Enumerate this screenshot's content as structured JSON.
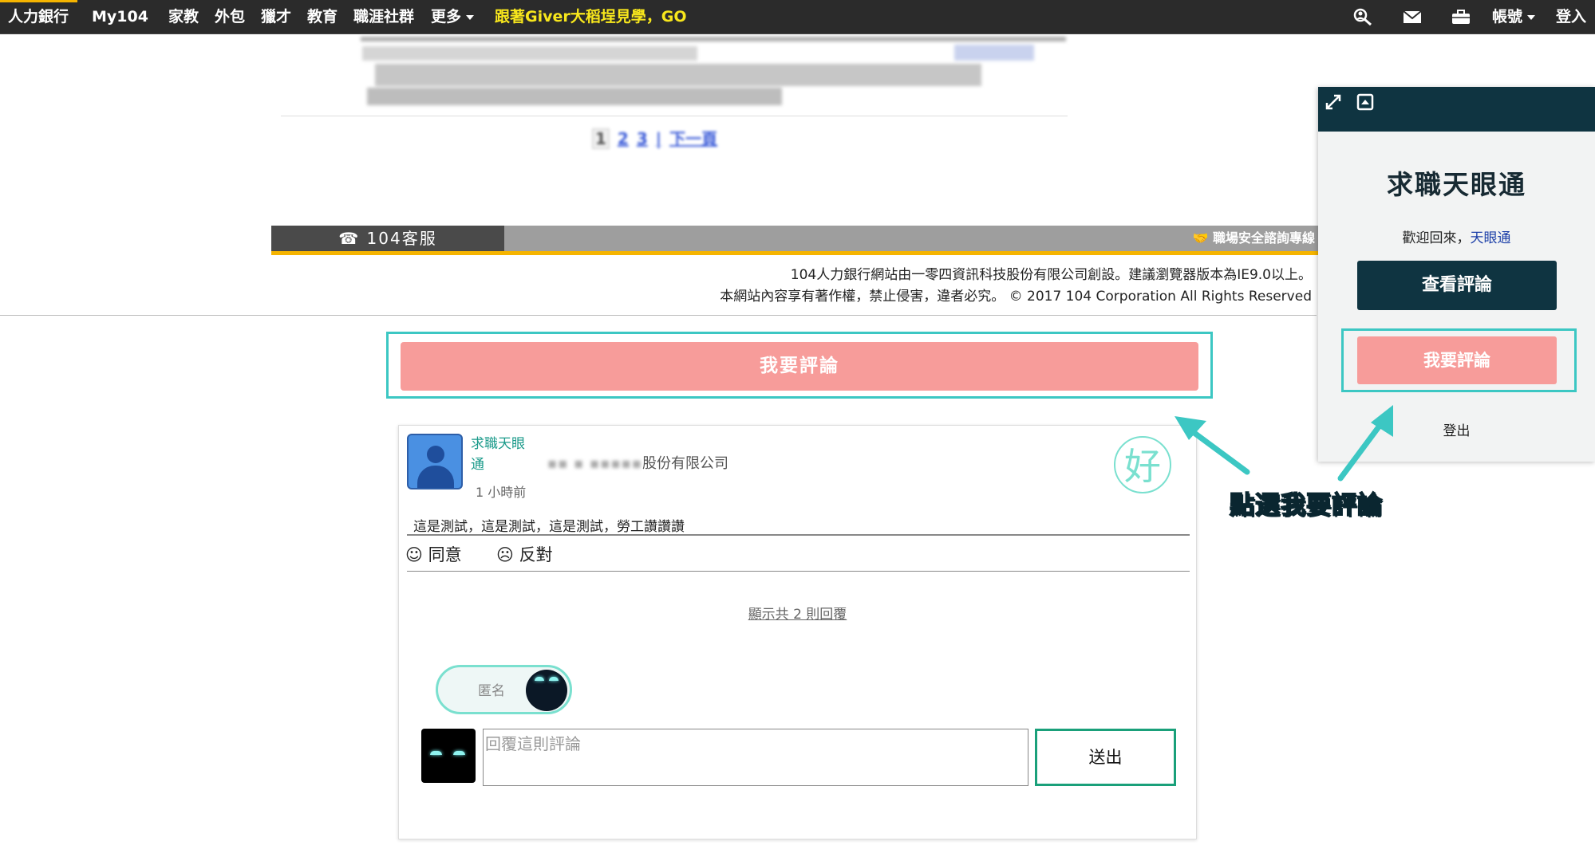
{
  "nav": {
    "items": [
      {
        "label": "人力銀行"
      },
      {
        "label": "My104"
      },
      {
        "label": "家教"
      },
      {
        "label": "外包"
      },
      {
        "label": "獵才"
      },
      {
        "label": "教育"
      },
      {
        "label": "職涯社群"
      },
      {
        "label": "更多"
      }
    ],
    "promo": "跟著Giver大稻埕見學，GO",
    "account": "帳號",
    "login": "登入",
    "icons": [
      "search-person-icon",
      "mail-icon",
      "briefcase-icon"
    ]
  },
  "footer": {
    "service": "104客服",
    "hotline": "職場安全諮詢專線",
    "line1": "104人力銀行網站由一零四資訊科技股份有限公司創設。建議瀏覽器版本為IE9.0以上。",
    "line2": "本網站內容享有著作權，禁止侵害，違者必究。 © 2017 104 Corporation All Rights Reserved"
  },
  "main": {
    "comment_button": "我要評論"
  },
  "comment": {
    "username": "求職天眼通",
    "company": "股份有限公司",
    "time": "1 小時前",
    "badge": "好",
    "text": "這是測試，這是測試，這是測試，勞工讚讚讚",
    "agree": "同意",
    "disagree": "反對",
    "replies": "顯示共 2 則回覆",
    "anonymous": "匿名",
    "reply_placeholder": "回覆這則評論",
    "send": "送出"
  },
  "panel": {
    "title": "求職天眼通",
    "welcome": "歡迎回來，",
    "welcome_name": "天眼通",
    "view_reviews": "查看評論",
    "write_review": "我要評論",
    "logout": "登出"
  },
  "annotation": "點選我要評論",
  "colors": {
    "nav_bg": "#2b2b2b",
    "accent_yellow": "#f5b400",
    "pink_button": "#f79c9a",
    "teal_highlight": "#3cc7c3",
    "panel_dark": "#0f3441",
    "green_text": "#1a9a8a"
  }
}
